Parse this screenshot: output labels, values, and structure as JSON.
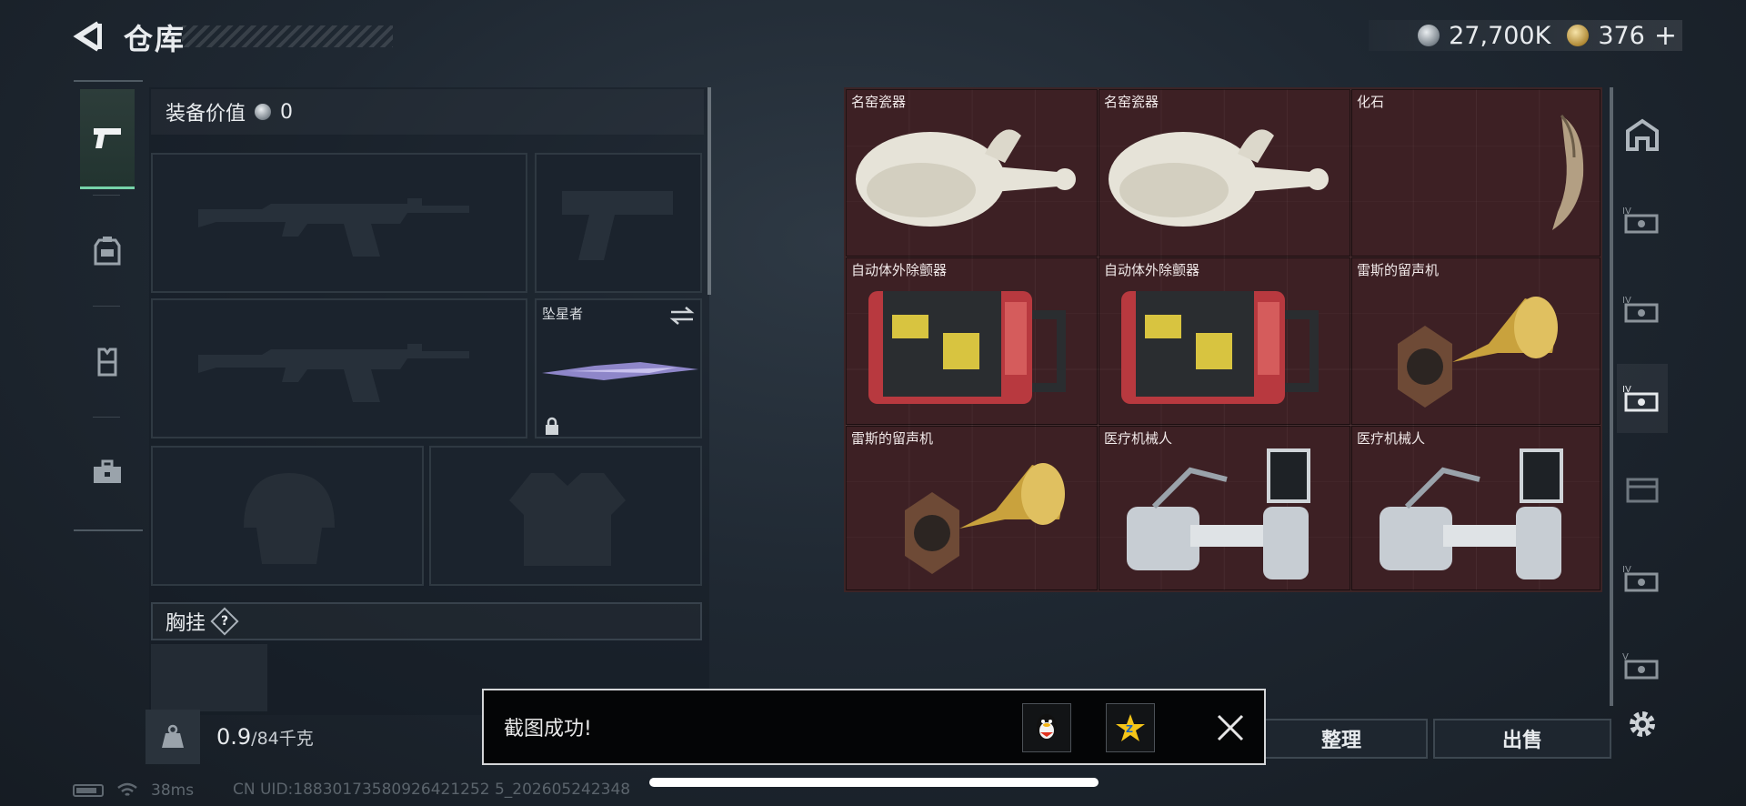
{
  "header": {
    "title": "仓库",
    "back_icon": "back-arrow-icon",
    "silver_amount": "27,700K",
    "gold_amount": "376",
    "gold_plus": "+"
  },
  "left_tabs": [
    {
      "name": "weapons",
      "icon": "pistol-icon",
      "active": true
    },
    {
      "name": "armor",
      "icon": "backpack-armor-icon",
      "active": false
    },
    {
      "name": "rig",
      "icon": "vest-icon",
      "active": false
    },
    {
      "name": "case",
      "icon": "briefcase-icon",
      "active": false
    }
  ],
  "equipment": {
    "value_label": "装备价值",
    "value": "0",
    "melee_label": "坠星者",
    "chest_label": "胸挂",
    "help": "?"
  },
  "weight": {
    "current": "0.9",
    "max": "/84千克"
  },
  "stash_items": [
    {
      "name": "名窑瓷器",
      "icon": "porcelain-vase-icon"
    },
    {
      "name": "名窑瓷器",
      "icon": "porcelain-vase-icon"
    },
    {
      "name": "化石",
      "icon": "fossil-claw-icon"
    },
    {
      "name": "自动体外除颤器",
      "icon": "defibrillator-icon"
    },
    {
      "name": "自动体外除颤器",
      "icon": "defibrillator-icon"
    },
    {
      "name": "雷斯的留声机",
      "icon": "gramophone-icon"
    },
    {
      "name": "雷斯的留声机",
      "icon": "gramophone-icon"
    },
    {
      "name": "医疗机械人",
      "icon": "medical-robot-icon"
    },
    {
      "name": "医疗机械人",
      "icon": "medical-robot-icon"
    }
  ],
  "right_tabs": [
    {
      "icon": "home-tab-icon"
    },
    {
      "icon": "case-tier-4-icon"
    },
    {
      "icon": "case-tier-4-icon"
    },
    {
      "icon": "case-tier-4-icon",
      "active": true
    },
    {
      "icon": "crate-icon"
    },
    {
      "icon": "case-tier-4-icon"
    },
    {
      "icon": "case-tier-5-icon"
    }
  ],
  "actions": {
    "sort": "整理",
    "sell": "出售"
  },
  "toast": {
    "message": "截图成功!"
  },
  "status": {
    "ping": "38ms",
    "uid": "CN UID:18830173580926421252 5_202605242348"
  },
  "colors": {
    "accent_green": "#76d3a9",
    "stash_red": "#3a1f22"
  }
}
